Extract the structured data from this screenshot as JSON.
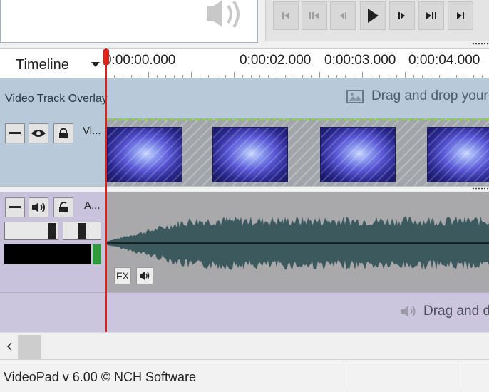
{
  "timeline": {
    "view_label": "Timeline",
    "ruler": [
      "0:00:00.000",
      "0:00:02.000",
      "0:00:03.000",
      "0:00:04.000"
    ]
  },
  "tracks": {
    "overlay_label": "Video Track Overlay",
    "overlay_drop_text": "Drag and drop your vi",
    "video_label": "Vi...",
    "audio_label": "A...",
    "fx_label": "FX",
    "audio_drop_text": "Drag and dr"
  },
  "status": {
    "text": "VideoPad v 6.00 © NCH Software"
  },
  "colors": {
    "playhead": "#e0201a",
    "meter_level": "#2f9a3c",
    "waveform": "#3c5a5e"
  }
}
